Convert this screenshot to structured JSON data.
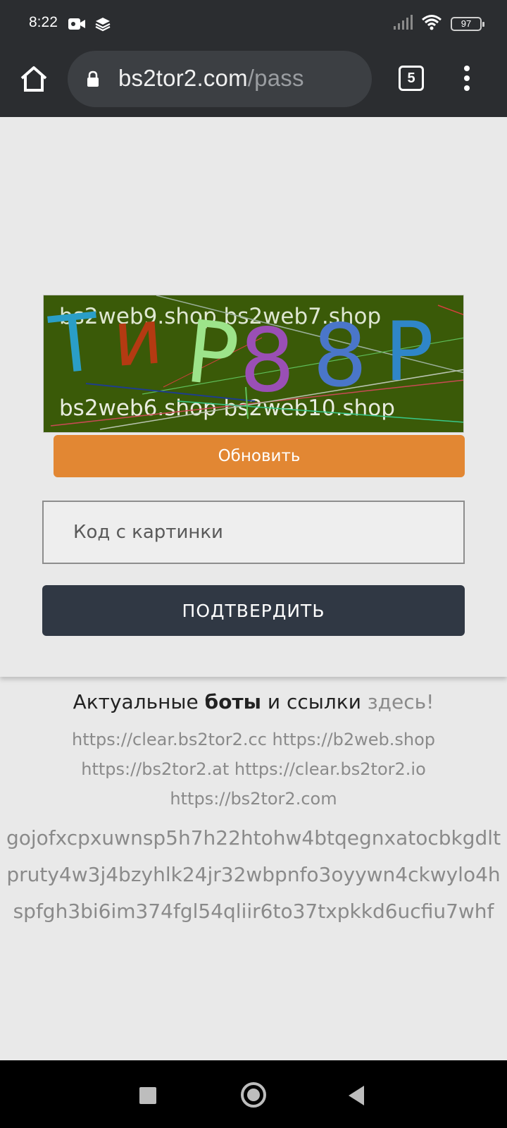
{
  "status_bar": {
    "time": "8:22",
    "battery": "97",
    "icons": [
      "video-camera-icon",
      "layers-icon",
      "signal-icon",
      "wifi-icon",
      "battery-icon"
    ]
  },
  "browser": {
    "url_domain": "bs2tor2.com",
    "url_path": "/pass",
    "tab_count": "5"
  },
  "captcha": {
    "noise_texts": [
      "bs2web9.shop bs2web7.shop",
      "bs2web6.shop bs2web10.shop"
    ],
    "characters": [
      "T",
      "и",
      "P",
      "8",
      "8",
      "P"
    ],
    "colors": [
      "#2a9ec7",
      "#b43a12",
      "#9de48a",
      "#9a4fb5",
      "#4a76c9",
      "#2f86c8"
    ],
    "background": "#3a5a08"
  },
  "buttons": {
    "refresh": "Обновить",
    "confirm": "ПОДТВЕРДИТЬ"
  },
  "code_input": {
    "placeholder": "Код с картинки",
    "value": ""
  },
  "links": {
    "prefix": "Актуальные ",
    "bold": "боты",
    "middle": " и ссылки ",
    "here": "здесь!",
    "line1": "https://clear.bs2tor2.cc https://b2web.shop",
    "line2": "https://bs2tor2.at https://clear.bs2tor2.io",
    "line3": "https://bs2tor2.com",
    "onion1": "gojofxcpxuwnsp5h7h22htohw4btqegnxatocbkgdlt",
    "onion2": "pruty4w3j4bzyhlk24jr32wbpnfo3oyywn4ckwylo4h",
    "onion3": "spfgh3bi6im374fgl54qliir6to37txpkkd6ucfiu7whf"
  },
  "colors": {
    "refresh_button": "#e28733",
    "confirm_button": "#303844",
    "browser_bar": "#2b2d30"
  }
}
